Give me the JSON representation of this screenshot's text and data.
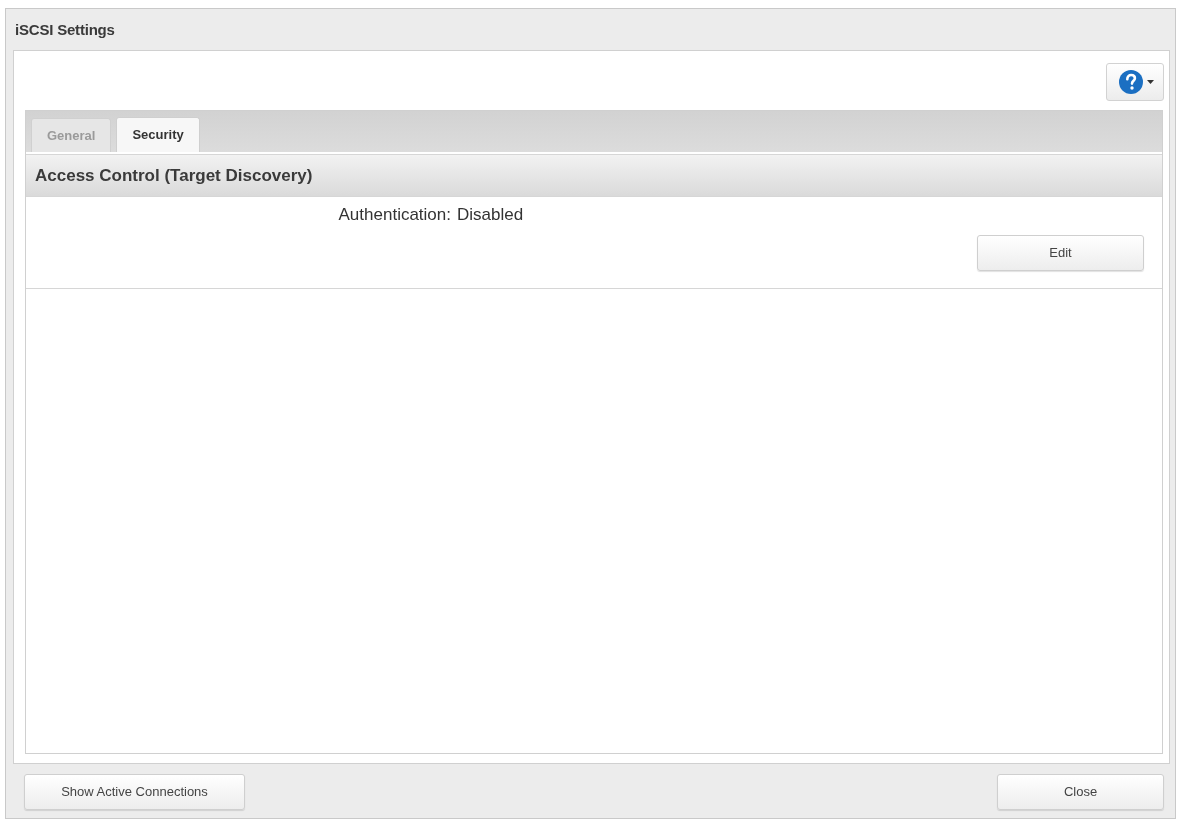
{
  "window": {
    "title": "iSCSI Settings"
  },
  "tabs": [
    {
      "label": "General",
      "selected": false
    },
    {
      "label": "Security",
      "selected": true
    }
  ],
  "section": {
    "title": "Access Control (Target Discovery)",
    "fields": [
      {
        "label": "Authentication:",
        "value": "Disabled"
      }
    ],
    "buttons": [
      "Edit"
    ]
  },
  "footer": {
    "left_buttons": [
      "Show Active Connections"
    ],
    "right_buttons": [
      "Close"
    ]
  }
}
